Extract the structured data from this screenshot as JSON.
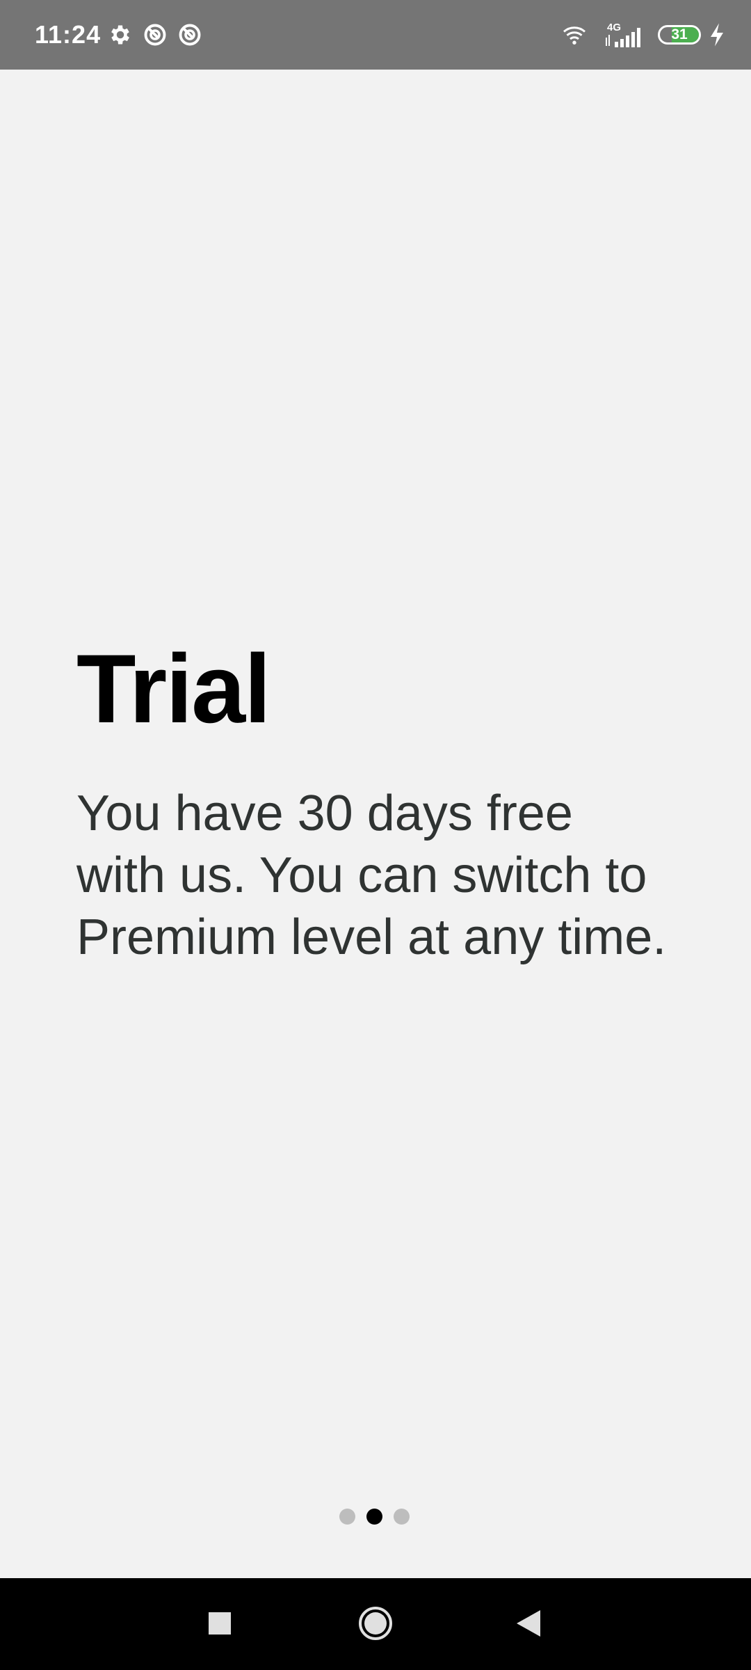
{
  "status_bar": {
    "time": "11:24",
    "network_label": "4G",
    "battery_level": 31,
    "battery_label": "31",
    "battery_color": "#4caf50",
    "icons": [
      "gear-icon",
      "do-not-disturb-icon",
      "do-not-disturb-icon",
      "wifi-icon",
      "cell-signal-icon",
      "battery-icon",
      "charging-bolt-icon"
    ]
  },
  "onboarding": {
    "title": "Trial",
    "body": "You have 30 days free with us. You can switch to Premium level at any time.",
    "page_count": 3,
    "current_page": 2
  },
  "nav_bar": {
    "buttons": [
      "recents-button",
      "home-button",
      "back-button"
    ]
  }
}
